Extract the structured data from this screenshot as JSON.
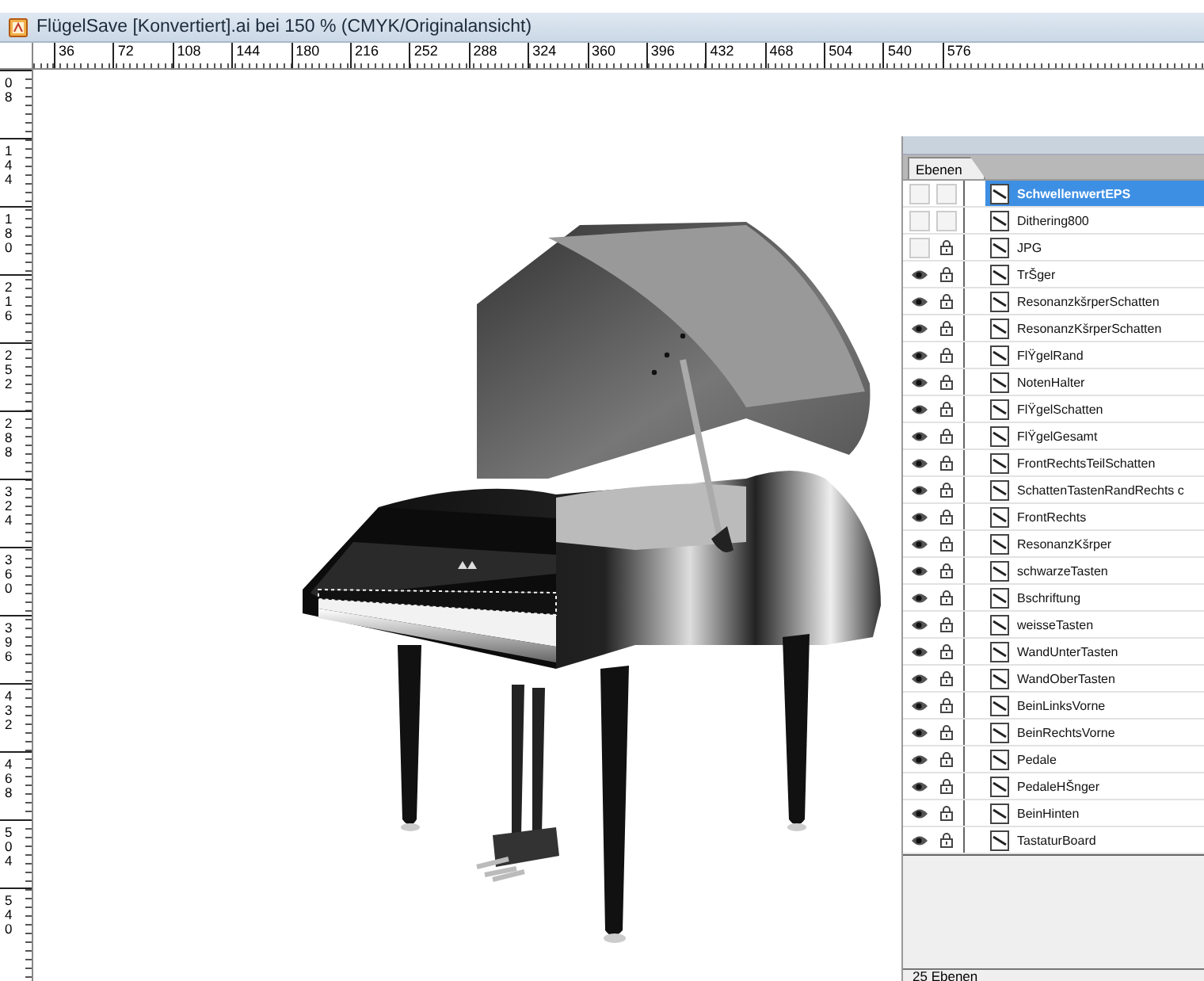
{
  "window": {
    "title": "FlügelSave [Konvertiert].ai bei 150 % (CMYK/Originalansicht)"
  },
  "top_ruler": {
    "labels": [
      "36",
      "72",
      "108",
      "144",
      "180",
      "216",
      "252",
      "288",
      "324",
      "360",
      "396",
      "432",
      "468",
      "504",
      "540",
      "576"
    ]
  },
  "left_ruler": {
    "labels": [
      "08",
      "144",
      "180",
      "216",
      "252",
      "288",
      "324",
      "360",
      "396",
      "432",
      "468",
      "504",
      "540"
    ]
  },
  "layers_panel": {
    "tabs": [
      {
        "label": "Ebenen",
        "selected": true
      }
    ],
    "layers": [
      {
        "name": "SchwellenwertEPS",
        "visible": false,
        "locked": false,
        "selected": true
      },
      {
        "name": "Dithering800",
        "visible": false,
        "locked": false,
        "selected": false
      },
      {
        "name": "JPG",
        "visible": false,
        "locked": true,
        "selected": false
      },
      {
        "name": "TrŠger",
        "visible": true,
        "locked": true,
        "selected": false
      },
      {
        "name": "ResonanzkšrperSchatten",
        "visible": true,
        "locked": true,
        "selected": false
      },
      {
        "name": "ResonanzKšrperSchatten",
        "visible": true,
        "locked": true,
        "selected": false
      },
      {
        "name": "FlŸgelRand",
        "visible": true,
        "locked": true,
        "selected": false
      },
      {
        "name": "NotenHalter",
        "visible": true,
        "locked": true,
        "selected": false
      },
      {
        "name": "FlŸgelSchatten",
        "visible": true,
        "locked": true,
        "selected": false
      },
      {
        "name": "FlŸgelGesamt",
        "visible": true,
        "locked": true,
        "selected": false
      },
      {
        "name": "FrontRechtsTeilSchatten",
        "visible": true,
        "locked": true,
        "selected": false
      },
      {
        "name": "SchattenTastenRandRechts c",
        "visible": true,
        "locked": true,
        "selected": false
      },
      {
        "name": "FrontRechts",
        "visible": true,
        "locked": true,
        "selected": false
      },
      {
        "name": "ResonanzKšrper",
        "visible": true,
        "locked": true,
        "selected": false
      },
      {
        "name": "schwarzeTasten",
        "visible": true,
        "locked": true,
        "selected": false
      },
      {
        "name": "Bschriftung",
        "visible": true,
        "locked": true,
        "selected": false
      },
      {
        "name": "weisseTasten",
        "visible": true,
        "locked": true,
        "selected": false
      },
      {
        "name": "WandUnterTasten",
        "visible": true,
        "locked": true,
        "selected": false
      },
      {
        "name": "WandOberTasten",
        "visible": true,
        "locked": true,
        "selected": false
      },
      {
        "name": "BeinLinksVorne",
        "visible": true,
        "locked": true,
        "selected": false
      },
      {
        "name": "BeinRechtsVorne",
        "visible": true,
        "locked": true,
        "selected": false
      },
      {
        "name": "Pedale",
        "visible": true,
        "locked": true,
        "selected": false
      },
      {
        "name": "PedaleHŠnger",
        "visible": true,
        "locked": true,
        "selected": false
      },
      {
        "name": "BeinHinten",
        "visible": true,
        "locked": true,
        "selected": false
      },
      {
        "name": "TastaturBoard",
        "visible": true,
        "locked": true,
        "selected": false
      }
    ],
    "footer": "25 Ebenen"
  }
}
